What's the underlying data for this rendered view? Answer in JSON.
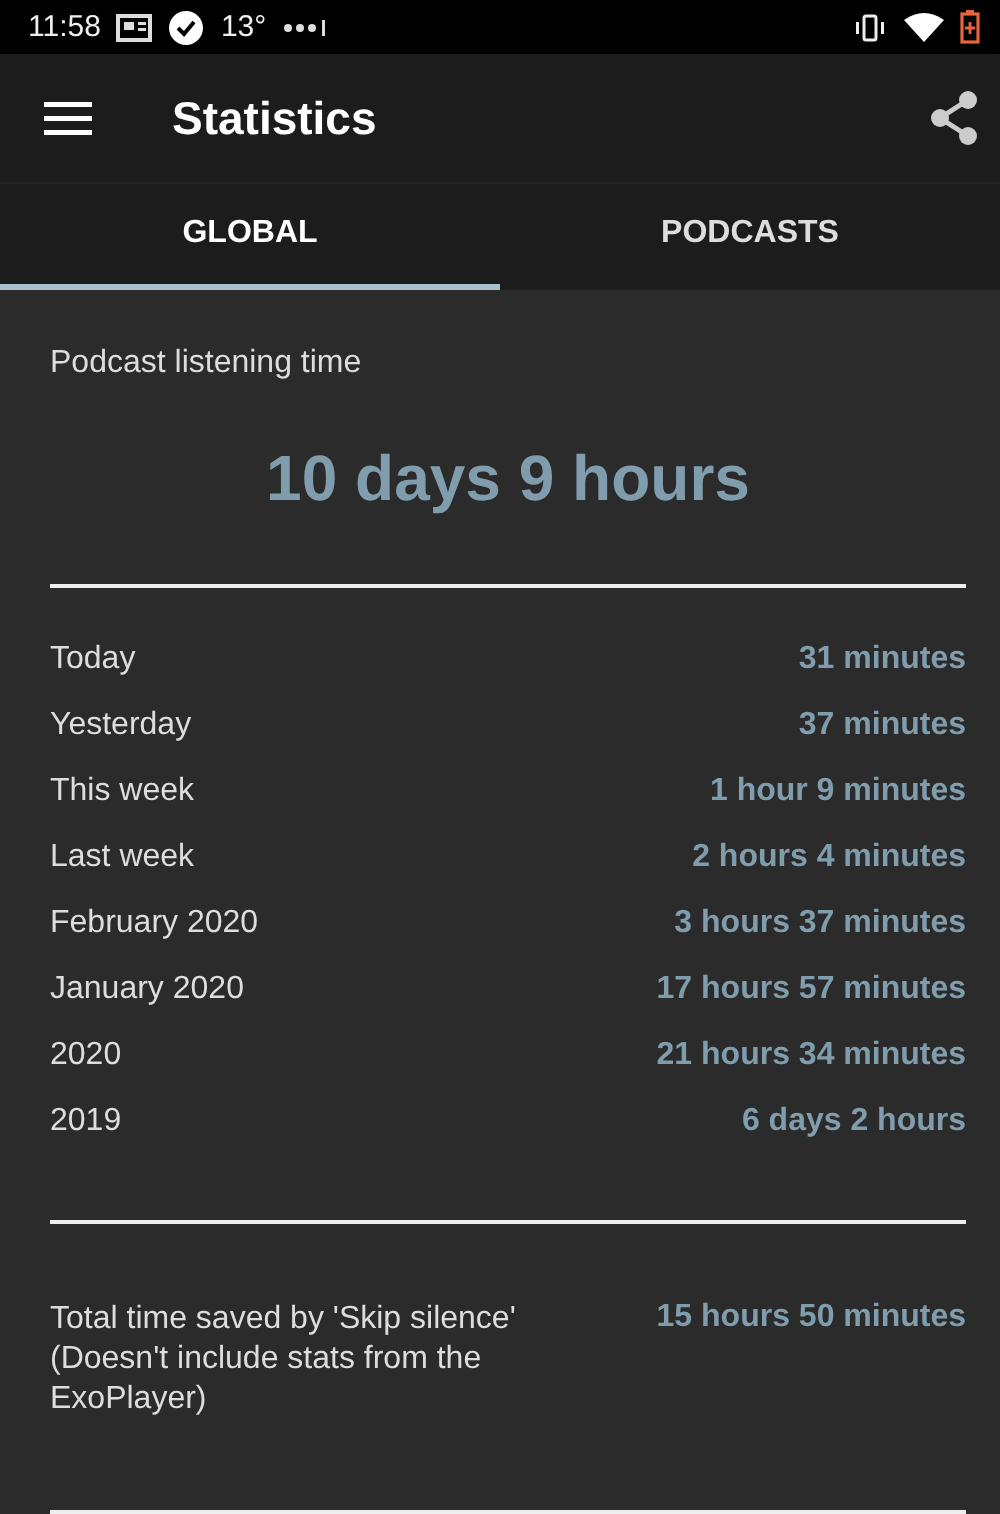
{
  "status_bar": {
    "time": "11:58",
    "temperature": "13°"
  },
  "toolbar": {
    "title": "Statistics"
  },
  "tabs": [
    {
      "label": "GLOBAL",
      "selected": true
    },
    {
      "label": "PODCASTS",
      "selected": false
    }
  ],
  "summary": {
    "label": "Podcast listening time",
    "value": "10 days 9 hours"
  },
  "periods": [
    {
      "label": "Today",
      "value": "31 minutes"
    },
    {
      "label": "Yesterday",
      "value": "37 minutes"
    },
    {
      "label": "This week",
      "value": "1 hour 9 minutes"
    },
    {
      "label": "Last week",
      "value": "2 hours 4 minutes"
    },
    {
      "label": "February 2020",
      "value": "3 hours 37 minutes"
    },
    {
      "label": "January 2020",
      "value": "17 hours 57 minutes"
    },
    {
      "label": "2020",
      "value": "21 hours 34 minutes"
    },
    {
      "label": "2019",
      "value": "6 days 2 hours"
    }
  ],
  "skip_silence": {
    "label": "Total time saved by 'Skip silence' (Doesn't include stats from the ExoPlayer)",
    "value": "15 hours 50 minutes"
  }
}
